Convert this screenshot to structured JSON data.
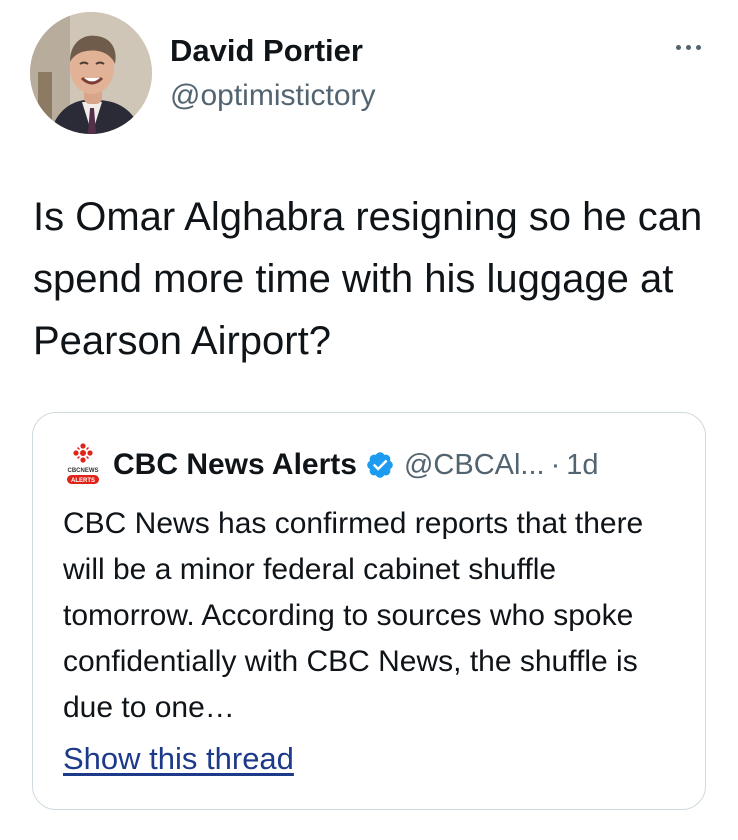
{
  "tweet": {
    "author": {
      "name": "David Portier",
      "handle": "@optimistictory",
      "avatar": "profile-photo"
    },
    "more_icon": "more-horizontal-icon",
    "text": "Is Omar Alghabra resigning so he can spend more time with his luggage at Pearson Airport?",
    "quote": {
      "logo": "cbc-news-alerts-logo",
      "logo_text_top": "CBCNEWS",
      "logo_text_bottom": "ALERTS",
      "name": "CBC News Alerts",
      "verified_icon": "verified-badge-icon",
      "handle": "@CBCAl...",
      "separator": "·",
      "time": "1d",
      "text": "CBC News has confirmed reports that there will be a minor federal cabinet shuffle tomorrow.  According to sources who spoke confidentially with CBC News, the shuffle is due to one…",
      "show_thread": "Show this thread"
    },
    "colors": {
      "text": "#0f1419",
      "secondary": "#536471",
      "border": "#cfd9de",
      "verified": "#1d9bf0",
      "link": "#1d3a8a",
      "cbc_red": "#e2231a"
    }
  }
}
